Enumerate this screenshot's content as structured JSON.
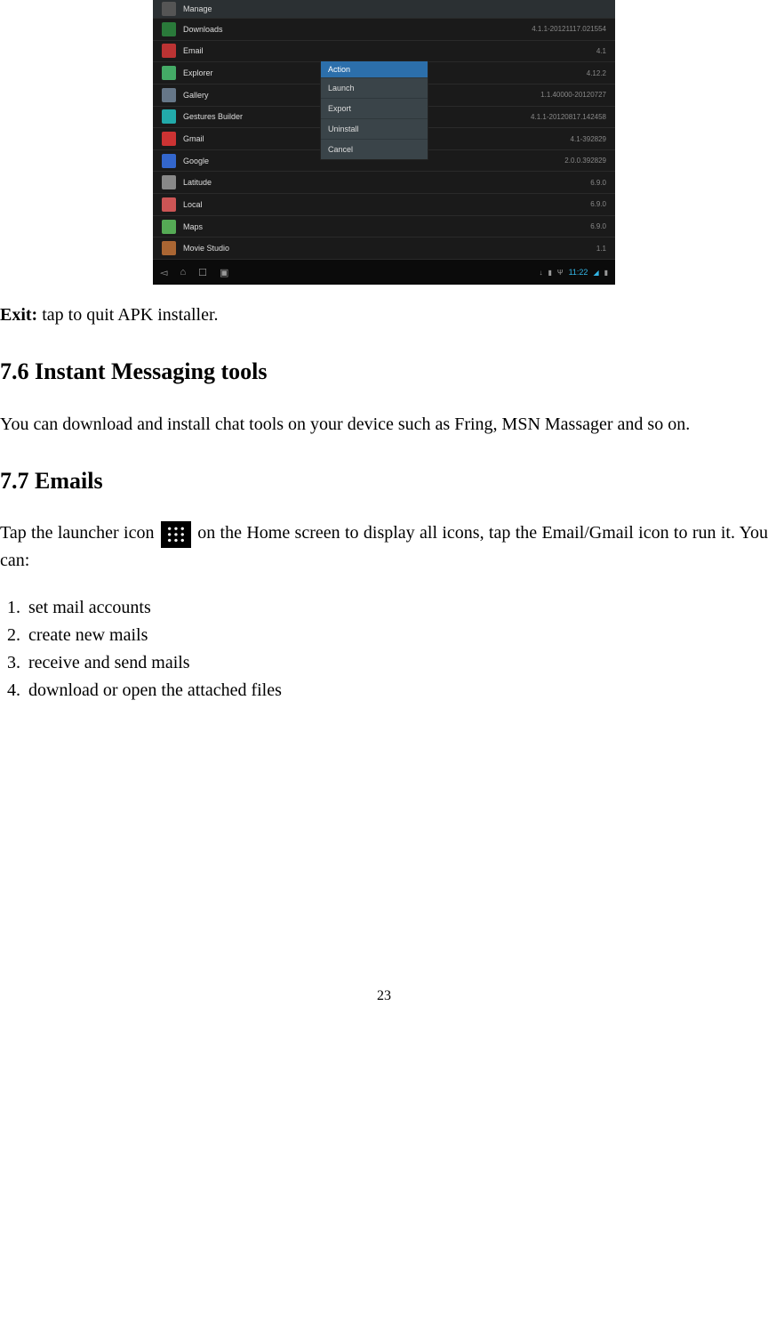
{
  "screenshot": {
    "header_label": "Manage",
    "apps": [
      {
        "name": "Downloads",
        "version": "4.1.1-20121117.021554",
        "icon": "downloads"
      },
      {
        "name": "Email",
        "version": "4.1",
        "icon": "email"
      },
      {
        "name": "Explorer",
        "version": "4.12.2",
        "icon": "explorer"
      },
      {
        "name": "Gallery",
        "version": "1.1.40000-20120727",
        "icon": "gallery"
      },
      {
        "name": "Gestures Builder",
        "version": "4.1.1-20120817.142458",
        "icon": "gestures"
      },
      {
        "name": "Gmail",
        "version": "4.1-392829",
        "icon": "gmail"
      },
      {
        "name": "Google",
        "version": "2.0.0.392829",
        "icon": "google"
      },
      {
        "name": "Latitude",
        "version": "6.9.0",
        "icon": "latitude"
      },
      {
        "name": "Local",
        "version": "6.9.0",
        "icon": "local"
      },
      {
        "name": "Maps",
        "version": "6.9.0",
        "icon": "maps"
      },
      {
        "name": "Movie Studio",
        "version": "1.1",
        "icon": "movie"
      }
    ],
    "action_popup": {
      "header": "Action",
      "items": [
        "Launch",
        "Export",
        "Uninstall",
        "Cancel"
      ]
    },
    "statusbar": {
      "time": "11:22"
    }
  },
  "exit": {
    "label": "Exit:",
    "text": " tap to quit APK installer."
  },
  "section_im": {
    "heading": "7.6 Instant Messaging tools",
    "body": "You can download and install chat tools on your device such as Fring, MSN Massager and so on."
  },
  "section_emails": {
    "heading": "7.7 Emails",
    "intro_part1": "Tap  the  launcher  icon ",
    "intro_part2": " on  the  Home  screen  to  display  all  icons,  tap  the Email/Gmail icon to run it. You can:",
    "list": [
      "set mail accounts",
      "create new mails",
      "receive and send mails",
      "download or open the attached files"
    ]
  },
  "page_number": "23"
}
